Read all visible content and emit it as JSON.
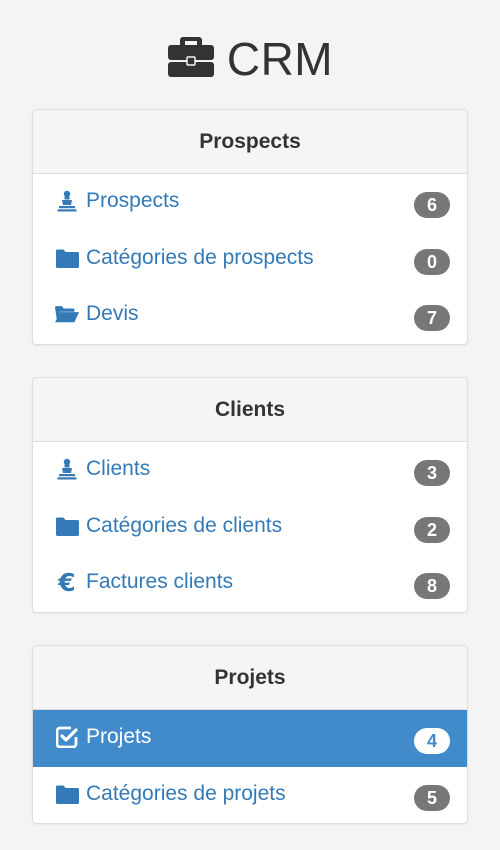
{
  "header": {
    "title": "CRM",
    "icon": "briefcase-icon"
  },
  "colors": {
    "link": "#337ab7",
    "active_bg": "#428bca",
    "badge_bg": "#777777",
    "panel_heading_bg": "#f5f5f5",
    "page_bg": "#f4f4f4"
  },
  "panels": [
    {
      "title": "Prospects",
      "items": [
        {
          "label": "Prospects",
          "count": "6",
          "icon": "chess-pawn-icon",
          "active": false
        },
        {
          "label": "Catégories de prospects",
          "count": "0",
          "icon": "folder-icon",
          "active": false
        },
        {
          "label": "Devis",
          "count": "7",
          "icon": "folder-open-icon",
          "active": false
        }
      ]
    },
    {
      "title": "Clients",
      "items": [
        {
          "label": "Clients",
          "count": "3",
          "icon": "chess-pawn-icon",
          "active": false
        },
        {
          "label": "Catégories de clients",
          "count": "2",
          "icon": "folder-icon",
          "active": false
        },
        {
          "label": "Factures clients",
          "count": "8",
          "icon": "euro-icon",
          "active": false
        }
      ]
    },
    {
      "title": "Projets",
      "items": [
        {
          "label": "Projets",
          "count": "4",
          "icon": "checkbox-checked-icon",
          "active": true
        },
        {
          "label": "Catégories de projets",
          "count": "5",
          "icon": "folder-icon",
          "active": false
        }
      ]
    }
  ]
}
